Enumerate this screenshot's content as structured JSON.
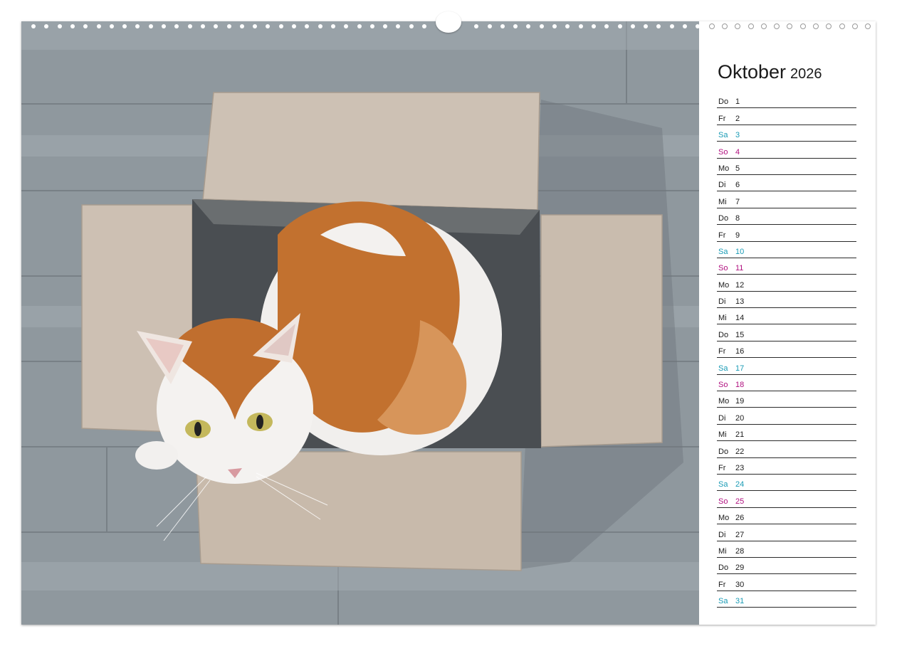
{
  "calendar": {
    "month": "Oktober",
    "year": "2026",
    "colors": {
      "weekday": "#1a1a1a",
      "saturday": "#1a9bb5",
      "sunday": "#b0107f"
    },
    "days": [
      {
        "wd": "Do",
        "d": "1",
        "type": "weekday"
      },
      {
        "wd": "Fr",
        "d": "2",
        "type": "weekday"
      },
      {
        "wd": "Sa",
        "d": "3",
        "type": "sat"
      },
      {
        "wd": "So",
        "d": "4",
        "type": "sun"
      },
      {
        "wd": "Mo",
        "d": "5",
        "type": "weekday"
      },
      {
        "wd": "Di",
        "d": "6",
        "type": "weekday"
      },
      {
        "wd": "Mi",
        "d": "7",
        "type": "weekday"
      },
      {
        "wd": "Do",
        "d": "8",
        "type": "weekday"
      },
      {
        "wd": "Fr",
        "d": "9",
        "type": "weekday"
      },
      {
        "wd": "Sa",
        "d": "10",
        "type": "sat"
      },
      {
        "wd": "So",
        "d": "11",
        "type": "sun"
      },
      {
        "wd": "Mo",
        "d": "12",
        "type": "weekday"
      },
      {
        "wd": "Di",
        "d": "13",
        "type": "weekday"
      },
      {
        "wd": "Mi",
        "d": "14",
        "type": "weekday"
      },
      {
        "wd": "Do",
        "d": "15",
        "type": "weekday"
      },
      {
        "wd": "Fr",
        "d": "16",
        "type": "weekday"
      },
      {
        "wd": "Sa",
        "d": "17",
        "type": "sat"
      },
      {
        "wd": "So",
        "d": "18",
        "type": "sun"
      },
      {
        "wd": "Mo",
        "d": "19",
        "type": "weekday"
      },
      {
        "wd": "Di",
        "d": "20",
        "type": "weekday"
      },
      {
        "wd": "Mi",
        "d": "21",
        "type": "weekday"
      },
      {
        "wd": "Do",
        "d": "22",
        "type": "weekday"
      },
      {
        "wd": "Fr",
        "d": "23",
        "type": "weekday"
      },
      {
        "wd": "Sa",
        "d": "24",
        "type": "sat"
      },
      {
        "wd": "So",
        "d": "25",
        "type": "sun"
      },
      {
        "wd": "Mo",
        "d": "26",
        "type": "weekday"
      },
      {
        "wd": "Di",
        "d": "27",
        "type": "weekday"
      },
      {
        "wd": "Mi",
        "d": "28",
        "type": "weekday"
      },
      {
        "wd": "Do",
        "d": "29",
        "type": "weekday"
      },
      {
        "wd": "Fr",
        "d": "30",
        "type": "weekday"
      },
      {
        "wd": "Sa",
        "d": "31",
        "type": "sat"
      }
    ]
  },
  "photo": {
    "subject": "cat-in-cardboard-box",
    "colors": {
      "floor": "#8e979d",
      "box": "#c9bcae",
      "cat_orange": "#c0702f",
      "cat_white": "#f3f1ef"
    }
  }
}
